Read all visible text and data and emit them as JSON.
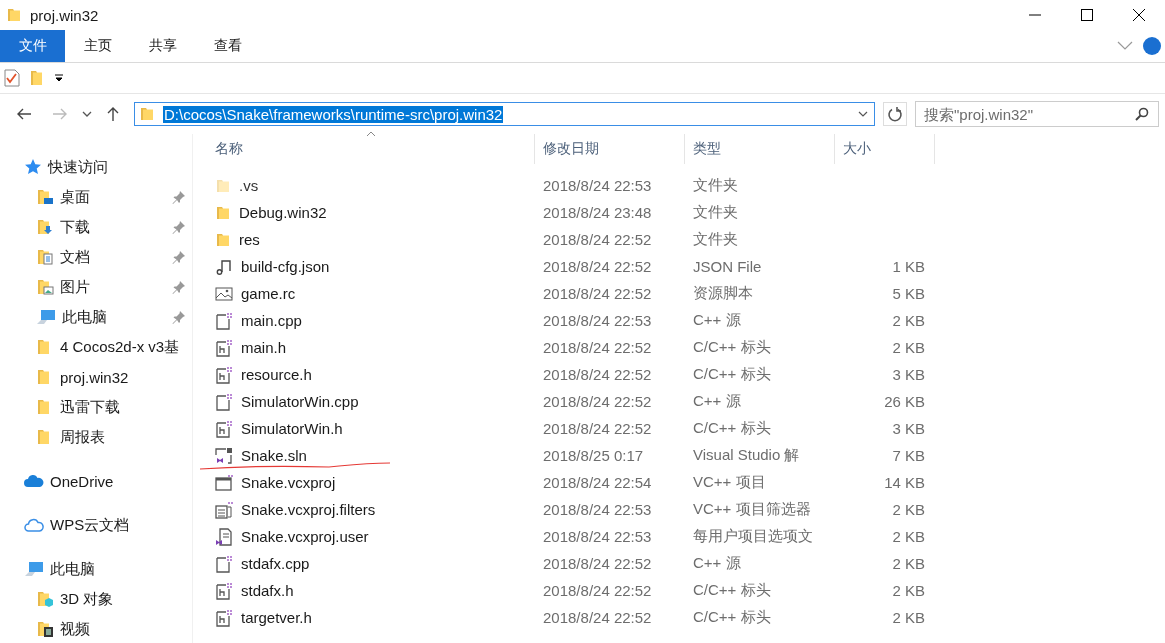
{
  "window": {
    "title": "proj.win32"
  },
  "ribbon_tabs": [
    {
      "label": "文件",
      "selected": true
    },
    {
      "label": "主页",
      "selected": false
    },
    {
      "label": "共享",
      "selected": false
    },
    {
      "label": "查看",
      "selected": false
    }
  ],
  "address": {
    "value": "D:\\cocos\\Snake\\frameworks\\runtime-src\\proj.win32"
  },
  "search": {
    "placeholder": "搜索\"proj.win32\""
  },
  "sidebar": {
    "sections": [
      {
        "label": "快速访问",
        "kind": "star",
        "children": [
          {
            "label": "桌面",
            "kind": "desktop",
            "pinned": true
          },
          {
            "label": "下载",
            "kind": "download",
            "pinned": true
          },
          {
            "label": "文档",
            "kind": "document",
            "pinned": true
          },
          {
            "label": "图片",
            "kind": "picture",
            "pinned": true
          },
          {
            "label": "此电脑",
            "kind": "computer",
            "pinned": true
          },
          {
            "label": "4 Cocos2d-x v3基",
            "kind": "folder",
            "pinned": false
          },
          {
            "label": "proj.win32",
            "kind": "folder",
            "pinned": false
          },
          {
            "label": "迅雷下载",
            "kind": "folder",
            "pinned": false
          },
          {
            "label": "周报表",
            "kind": "folder",
            "pinned": false
          }
        ]
      },
      {
        "label": "OneDrive",
        "kind": "cloud"
      },
      {
        "label": "WPS云文档",
        "kind": "cloud-outline"
      },
      {
        "label": "此电脑",
        "kind": "computer",
        "children": [
          {
            "label": "3D 对象",
            "kind": "cube",
            "pinned": false
          },
          {
            "label": "视频",
            "kind": "video",
            "pinned": false
          }
        ]
      }
    ]
  },
  "table": {
    "columns": [
      "名称",
      "修改日期",
      "类型",
      "大小"
    ],
    "rows": [
      {
        "kind": "folder",
        "hidden": true,
        "marked": false,
        "name": ".vs",
        "date": "2018/8/24 22:53",
        "type": "文件夹"
      },
      {
        "kind": "folder",
        "hidden": false,
        "marked": false,
        "name": "Debug.win32",
        "date": "2018/8/24 23:48",
        "type": "文件夹"
      },
      {
        "kind": "folder",
        "hidden": false,
        "marked": false,
        "name": "res",
        "date": "2018/8/24 22:52",
        "type": "文件夹"
      },
      {
        "kind": "json",
        "hidden": false,
        "marked": false,
        "name": "build-cfg.json",
        "date": "2018/8/24 22:52",
        "type": "JSON File",
        "size": "1 KB"
      },
      {
        "kind": "image",
        "hidden": false,
        "marked": false,
        "name": "game.rc",
        "date": "2018/8/24 22:52",
        "type": "资源脚本",
        "size": "5 KB"
      },
      {
        "kind": "cpp",
        "hidden": false,
        "marked": false,
        "name": "main.cpp",
        "date": "2018/8/24 22:53",
        "type": "C++ 源",
        "size": "2 KB"
      },
      {
        "kind": "header",
        "hidden": false,
        "marked": false,
        "name": "main.h",
        "date": "2018/8/24 22:52",
        "type": "C/C++ 标头",
        "size": "2 KB"
      },
      {
        "kind": "header",
        "hidden": false,
        "marked": false,
        "name": "resource.h",
        "date": "2018/8/24 22:52",
        "type": "C/C++ 标头",
        "size": "3 KB"
      },
      {
        "kind": "cpp",
        "hidden": false,
        "marked": false,
        "name": "SimulatorWin.cpp",
        "date": "2018/8/24 22:52",
        "type": "C++ 源",
        "size": "26 KB"
      },
      {
        "kind": "header",
        "hidden": false,
        "marked": false,
        "name": "SimulatorWin.h",
        "date": "2018/8/24 22:52",
        "type": "C/C++ 标头",
        "size": "3 KB"
      },
      {
        "kind": "solution",
        "hidden": false,
        "marked": true,
        "name": "Snake.sln",
        "date": "2018/8/25 0:17",
        "type": "Visual Studio 解",
        "size": "7 KB"
      },
      {
        "kind": "project",
        "hidden": false,
        "marked": false,
        "name": "Snake.vcxproj",
        "date": "2018/8/24 22:54",
        "type": "VC++ 项目",
        "size": "14 KB"
      },
      {
        "kind": "filters",
        "hidden": false,
        "marked": false,
        "name": "Snake.vcxproj.filters",
        "date": "2018/8/24 22:53",
        "type": "VC++ 项目筛选器",
        "size": "2 KB"
      },
      {
        "kind": "user",
        "hidden": false,
        "marked": false,
        "name": "Snake.vcxproj.user",
        "date": "2018/8/24 22:53",
        "type": "每用户项目选项文",
        "size": "2 KB"
      },
      {
        "kind": "cpp",
        "hidden": false,
        "marked": false,
        "name": "stdafx.cpp",
        "date": "2018/8/24 22:52",
        "type": "C++ 源",
        "size": "2 KB"
      },
      {
        "kind": "header",
        "hidden": false,
        "marked": false,
        "name": "stdafx.h",
        "date": "2018/8/24 22:52",
        "type": "C/C++ 标头",
        "size": "2 KB"
      },
      {
        "kind": "header",
        "hidden": false,
        "marked": false,
        "name": "targetver.h",
        "date": "2018/8/24 22:52",
        "type": "C/C++ 标头",
        "size": "2 KB"
      }
    ]
  }
}
